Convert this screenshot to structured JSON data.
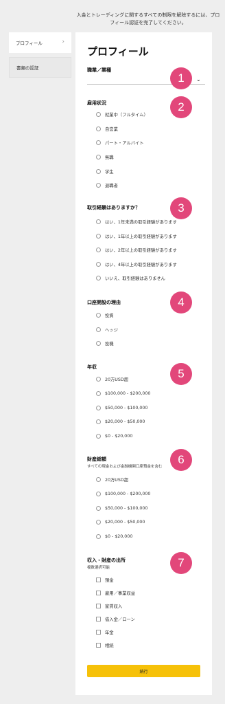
{
  "notice": "入金とトレーディングに関するすべての制限を解除するには、プロフィール認証を完了してください。",
  "sidebar": {
    "items": [
      {
        "label": "プロフィール",
        "icon": "chevron-right-icon"
      },
      {
        "label": "書類の認証"
      }
    ]
  },
  "main": {
    "title": "プロフィール",
    "occupation": {
      "label": "職業／業種",
      "value": ""
    },
    "employment": {
      "label": "雇用状況",
      "options": [
        "就業中（フルタイム）",
        "自営業",
        "パート・アルバイト",
        "無職",
        "学生",
        "退職者"
      ]
    },
    "experience": {
      "label": "取引経験はありますか？",
      "options": [
        "はい、1年未満の取引経験があります",
        "はい、1年以上の取引経験があります",
        "はい、2年以上の取引経験があります",
        "はい、4年以上の取引経験があります",
        "いいえ、取引経験はありません"
      ]
    },
    "purpose": {
      "label": "口座開設の理由",
      "options": [
        "投資",
        "ヘッジ",
        "投機"
      ]
    },
    "income": {
      "label": "年収",
      "options": [
        "20万USD超",
        "$100,000 - $200,000",
        "$50,000 - $100,000",
        "$20,000 - $50,000",
        "$0 - $20,000"
      ]
    },
    "assets": {
      "label": "財産総額",
      "sublabel": "すべての現金および金融機関口座預金を含む",
      "options": [
        "20万USD超",
        "$100,000 - $200,000",
        "$50,000 - $100,000",
        "$20,000 - $50,000",
        "$0 - $20,000"
      ]
    },
    "sources": {
      "label": "収入・財産の出所",
      "sublabel": "複数選択可能",
      "options": [
        "預金",
        "雇用／事業収益",
        "家賃収入",
        "借入金／ローン",
        "年金",
        "相続"
      ]
    },
    "continue_label": "続行"
  },
  "badges": [
    "1",
    "2",
    "3",
    "4",
    "5",
    "6",
    "7"
  ],
  "colors": {
    "badge": "#e2477a",
    "button": "#f6c109"
  }
}
